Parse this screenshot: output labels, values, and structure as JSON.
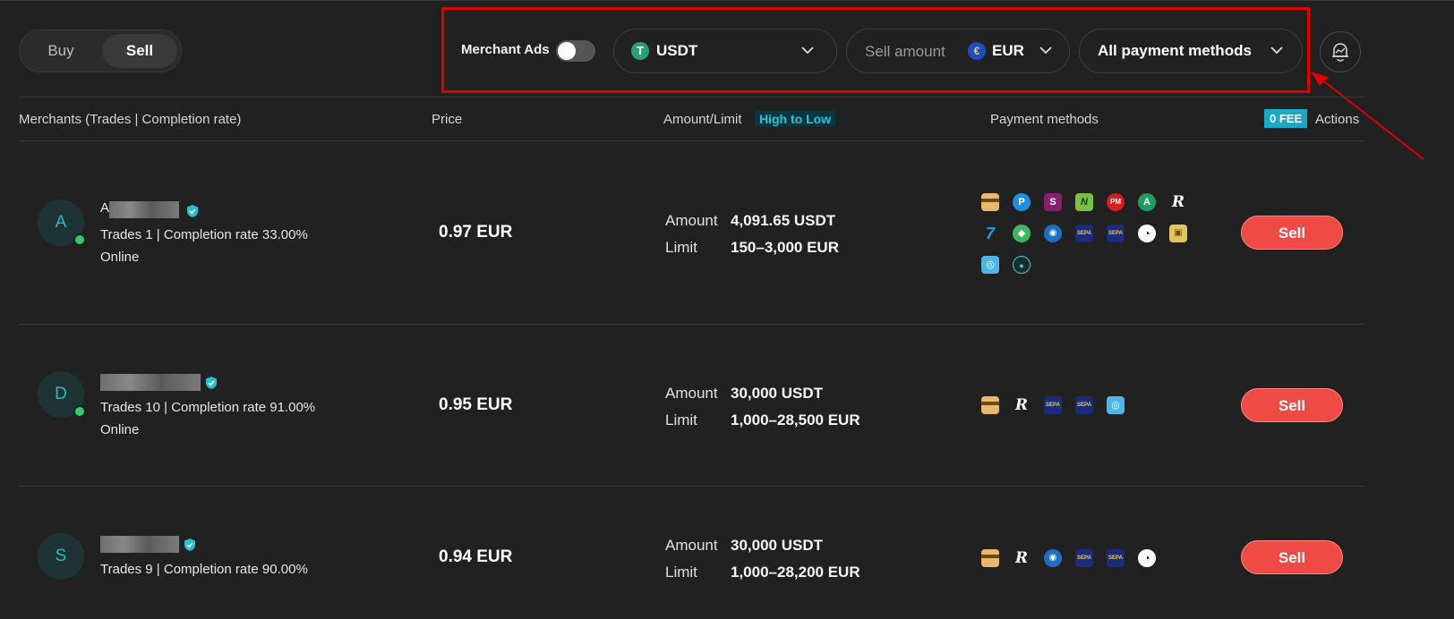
{
  "toggle": {
    "buy": "Buy",
    "sell": "Sell"
  },
  "filters": {
    "merchant_ads_label": "Merchant Ads",
    "coin": "USDT",
    "coin_icon_letter": "T",
    "amount_placeholder": "Sell amount",
    "currency": "EUR",
    "currency_icon_letter": "€",
    "payment": "All payment methods"
  },
  "headers": {
    "merchants": "Merchants (Trades | Completion rate)",
    "price": "Price",
    "amount_limit": "Amount/Limit",
    "sort": "High to Low",
    "payment_methods": "Payment methods",
    "fee_badge": "0 FEE",
    "actions": "Actions"
  },
  "labels": {
    "amount": "Amount",
    "limit": "Limit",
    "sell": "Sell"
  },
  "rows": [
    {
      "initial": "A",
      "name_fragment": "A",
      "stats": "Trades 1 | Completion rate 33.00%",
      "status": "Online",
      "price": "0.97 EUR",
      "amount": "4,091.65 USDT",
      "limit": "150–3,000 EUR",
      "payment_icons": [
        "card-icon",
        "paysera-icon",
        "skrill-icon",
        "neteller-icon",
        "perfect-money-icon",
        "advcash-icon",
        "revolut-icon",
        "wise-icon",
        "leaf-icon",
        "webmoney-icon",
        "sepa-icon",
        "sepa-icon",
        "ring-icon",
        "yellow-bank-icon",
        "p2p-icon",
        "dark-coin-icon"
      ]
    },
    {
      "initial": "D",
      "stats": "Trades 10 | Completion rate 91.00%",
      "status": "Online",
      "price": "0.95 EUR",
      "amount": "30,000 USDT",
      "limit": "1,000–28,500 EUR",
      "payment_icons": [
        "card-icon",
        "revolut-icon",
        "sepa-icon",
        "sepa-icon",
        "p2p-icon"
      ]
    },
    {
      "initial": "S",
      "stats": "Trades 9 | Completion rate 90.00%",
      "price": "0.94 EUR",
      "amount": "30,000 USDT",
      "limit": "1,000–28,200 EUR",
      "payment_icons": [
        "card-icon",
        "revolut-icon",
        "webmoney-icon",
        "sepa-icon",
        "sepa-icon",
        "ring-icon"
      ]
    }
  ],
  "colors": {
    "sell_button": "#f04a45",
    "highlight_box": "#e00000",
    "accent": "#1fc7e0",
    "online": "#2ecc71"
  }
}
